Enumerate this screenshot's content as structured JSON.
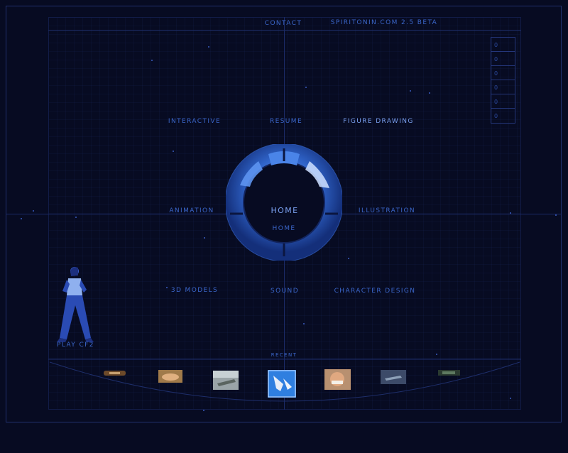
{
  "header": {
    "contact": "CONTACT",
    "site_title": "SPIRITONIN.COM 2.5 BETA"
  },
  "counter": [
    "0",
    "0",
    "0",
    "0",
    "0",
    "0"
  ],
  "nav": {
    "interactive": "INTERACTIVE",
    "resume": "RESUME",
    "figure_drawing": "FIGURE DRAWING",
    "animation": "ANIMATION",
    "home": "HOME",
    "home_sub": "HOME",
    "illustration": "ILLUSTRATION",
    "models_3d": "3D MODELS",
    "sound": "SOUND",
    "character_design": "CHARACTER DESIGN"
  },
  "play": {
    "label": "PLAY CF2"
  },
  "recent": {
    "label": "RECENT"
  },
  "colors": {
    "background": "#070b22",
    "nav_text": "#3b66c9",
    "highlight_text": "#7aa0ef",
    "ring_blue": "#2f63c8"
  }
}
